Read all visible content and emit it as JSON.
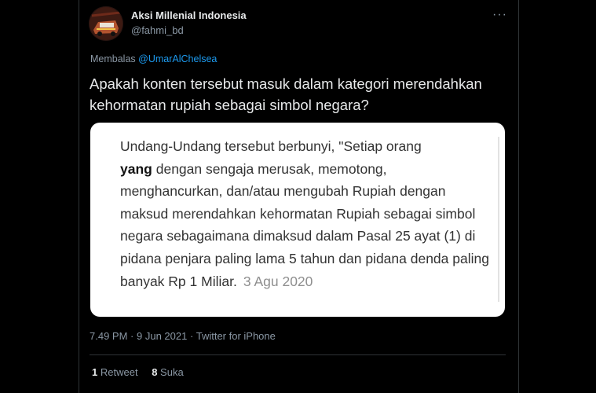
{
  "author": {
    "name": "Aksi Millenial Indonesia",
    "handle": "@fahmi_bd"
  },
  "reply": {
    "prefix": "Membalas",
    "mention": "@UmarAlChelsea"
  },
  "tweet_text": "Apakah konten tersebut masuk dalam kategori merendahkan kehormatan rupiah sebagai simbol negara?",
  "quote": {
    "text_start": "Undang-Undang tersebut berbunyi, \"Setiap orang",
    "text_bold": "yang",
    "text_rest": "dengan sengaja merusak, memotong, menghancurkan, dan/atau mengubah Rupiah dengan maksud merendahkan kehormatan Rupiah sebagai simbol negara sebagaimana dimaksud dalam Pasal 25 ayat (1) di pidana penjara paling lama 5 tahun dan pidana denda paling banyak Rp 1 Miliar.",
    "date": "3 Agu 2020"
  },
  "meta": {
    "time": "7.49 PM",
    "sep": "·",
    "date": "9 Jun 2021",
    "source": "Twitter for iPhone"
  },
  "stats": {
    "retweets": "1",
    "retweets_label": "Retweet",
    "likes": "8",
    "likes_label": "Suka"
  },
  "colors": {
    "background": "#000000",
    "text": "#e7e9ea",
    "muted": "#8b98a5",
    "link": "#1d9bf0",
    "quote_bg": "#ffffff"
  },
  "icons": {
    "more": "more-horizontal-icon"
  }
}
